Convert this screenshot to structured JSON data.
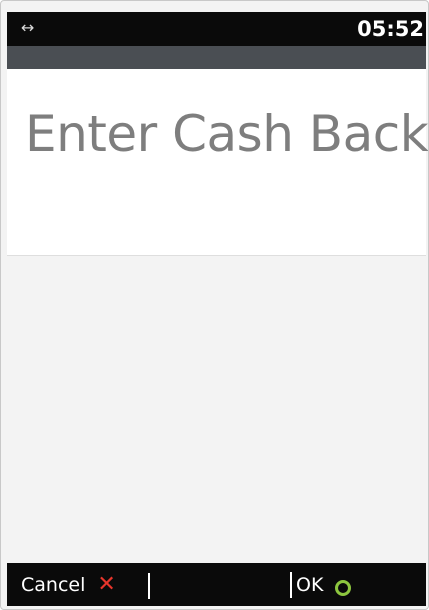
{
  "status_bar": {
    "connection_icon": "link-arrows-icon",
    "time": "05:52"
  },
  "screen": {
    "title": "Enter Cash Back"
  },
  "softkeys": {
    "cancel_label": "Cancel",
    "cancel_icon": "close-x-icon",
    "ok_label": "OK",
    "ok_icon": "circle-o-icon"
  },
  "colors": {
    "cancel_icon": "#e8352b",
    "ok_icon": "#8dc63f",
    "title_text": "#7e7e7e",
    "bar_background": "#0a0a0a",
    "sub_bar": "#4a4e53"
  }
}
